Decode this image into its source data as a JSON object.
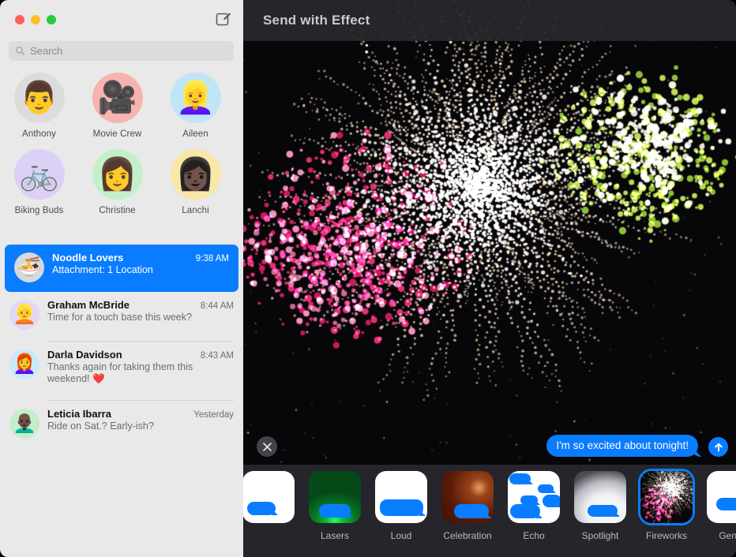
{
  "window": {
    "traffic_lights": [
      "close",
      "minimize",
      "zoom"
    ],
    "compose_icon": "compose-pencil-icon"
  },
  "sidebar": {
    "search": {
      "placeholder": "Search",
      "value": "",
      "icon": "search-icon"
    },
    "pinned": [
      {
        "name": "Anthony",
        "glyph": "👨",
        "bg": "#dcdcdc"
      },
      {
        "name": "Movie Crew",
        "glyph": "🎥",
        "bg": "#f7b3ae"
      },
      {
        "name": "Aileen",
        "glyph": "👱‍♀️",
        "bg": "#bfe5f7"
      },
      {
        "name": "Biking Buds",
        "glyph": "🚲",
        "bg": "#ddd0f7"
      },
      {
        "name": "Christine",
        "glyph": "👩",
        "bg": "#c3f0cb"
      },
      {
        "name": "Lanchi",
        "glyph": "👩🏿",
        "bg": "#f9e7a6"
      }
    ],
    "conversations": [
      {
        "name": "Noodle Lovers",
        "time": "9:38 AM",
        "preview": "Attachment: 1 Location",
        "glyph": "🍜",
        "bg": "#d8d8da",
        "selected": true
      },
      {
        "name": "Graham McBride",
        "time": "8:44 AM",
        "preview": "Time for a touch base this week?",
        "glyph": "👱",
        "bg": "#e3d7f7",
        "selected": false
      },
      {
        "name": "Darla Davidson",
        "time": "8:43 AM",
        "preview": "Thanks again for taking them this weekend! ❤️",
        "glyph": "👩‍🦰",
        "bg": "#c9e9f7",
        "selected": false
      },
      {
        "name": "Leticia Ibarra",
        "time": "Yesterday",
        "preview": "Ride on Sat.? Early-ish?",
        "glyph": "👨🏿‍🦲",
        "bg": "#c5eccb",
        "selected": false
      }
    ]
  },
  "preview_pane": {
    "title": "Send with Effect",
    "close_icon": "close-x-icon",
    "send_icon": "send-arrow-up-icon",
    "message_bubble": {
      "text": "I'm so excited about tonight!",
      "color": "#0a7cff"
    }
  },
  "effects": {
    "selected": "Fireworks",
    "accent": "#0a7cff",
    "items": [
      {
        "label": "",
        "style": "plain-partial",
        "clipped": true
      },
      {
        "label": "Lasers",
        "style": "lasers"
      },
      {
        "label": "Loud",
        "style": "loud"
      },
      {
        "label": "Celebration",
        "style": "celebration"
      },
      {
        "label": "Echo",
        "style": "echo"
      },
      {
        "label": "Spotlight",
        "style": "spotlight"
      },
      {
        "label": "Fireworks",
        "style": "fireworks"
      },
      {
        "label": "Gentle",
        "style": "gentle"
      }
    ]
  },
  "colors": {
    "sidebar_bg": "#e9e9e9",
    "selection_blue": "#0a7cff",
    "strip_bg": "#25252b",
    "stage_bg": "#000000"
  }
}
